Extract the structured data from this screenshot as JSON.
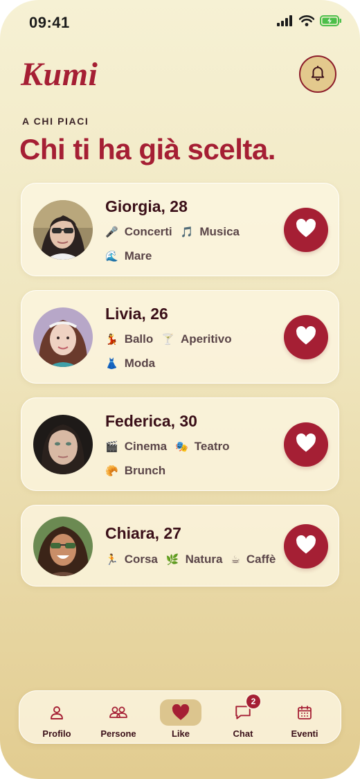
{
  "status_bar": {
    "time": "09:41"
  },
  "header": {
    "brand": "Kumi"
  },
  "section": {
    "eyebrow": "A CHI PIACI",
    "title": "Chi ti ha già scelta."
  },
  "colors": {
    "accent": "#a51f34",
    "name_text": "#3a0f18",
    "tag_text": "#5a4548"
  },
  "profiles": [
    {
      "name": "Giorgia, 28",
      "tags_row1": [
        {
          "emoji": "🎤",
          "label": "Concerti"
        },
        {
          "emoji": "🎵",
          "label": "Musica"
        }
      ],
      "tags_row2": [
        {
          "emoji": "🌊",
          "label": "Mare"
        }
      ]
    },
    {
      "name": "Livia, 26",
      "tags_row1": [
        {
          "emoji": "💃",
          "label": "Ballo"
        },
        {
          "emoji": "🍸",
          "label": "Aperitivo"
        }
      ],
      "tags_row2": [
        {
          "emoji": "👗",
          "label": "Moda"
        }
      ]
    },
    {
      "name": "Federica, 30",
      "tags_row1": [
        {
          "emoji": "🎬",
          "label": "Cinema"
        },
        {
          "emoji": "🎭",
          "label": "Teatro"
        }
      ],
      "tags_row2": [
        {
          "emoji": "🥐",
          "label": "Brunch"
        }
      ]
    },
    {
      "name": "Chiara, 27",
      "tags_row1": [
        {
          "emoji": "🏃",
          "label": "Corsa"
        },
        {
          "emoji": "🌿",
          "label": "Natura"
        },
        {
          "emoji": "☕",
          "label": "Caffè"
        }
      ],
      "tags_row2": []
    }
  ],
  "tab_bar": {
    "items": [
      {
        "label": "Profilo",
        "icon": "person-icon"
      },
      {
        "label": "Persone",
        "icon": "people-icon"
      },
      {
        "label": "Like",
        "icon": "heart-icon",
        "active": true
      },
      {
        "label": "Chat",
        "icon": "chat-icon",
        "badge": "2"
      },
      {
        "label": "Eventi",
        "icon": "calendar-icon"
      }
    ]
  }
}
